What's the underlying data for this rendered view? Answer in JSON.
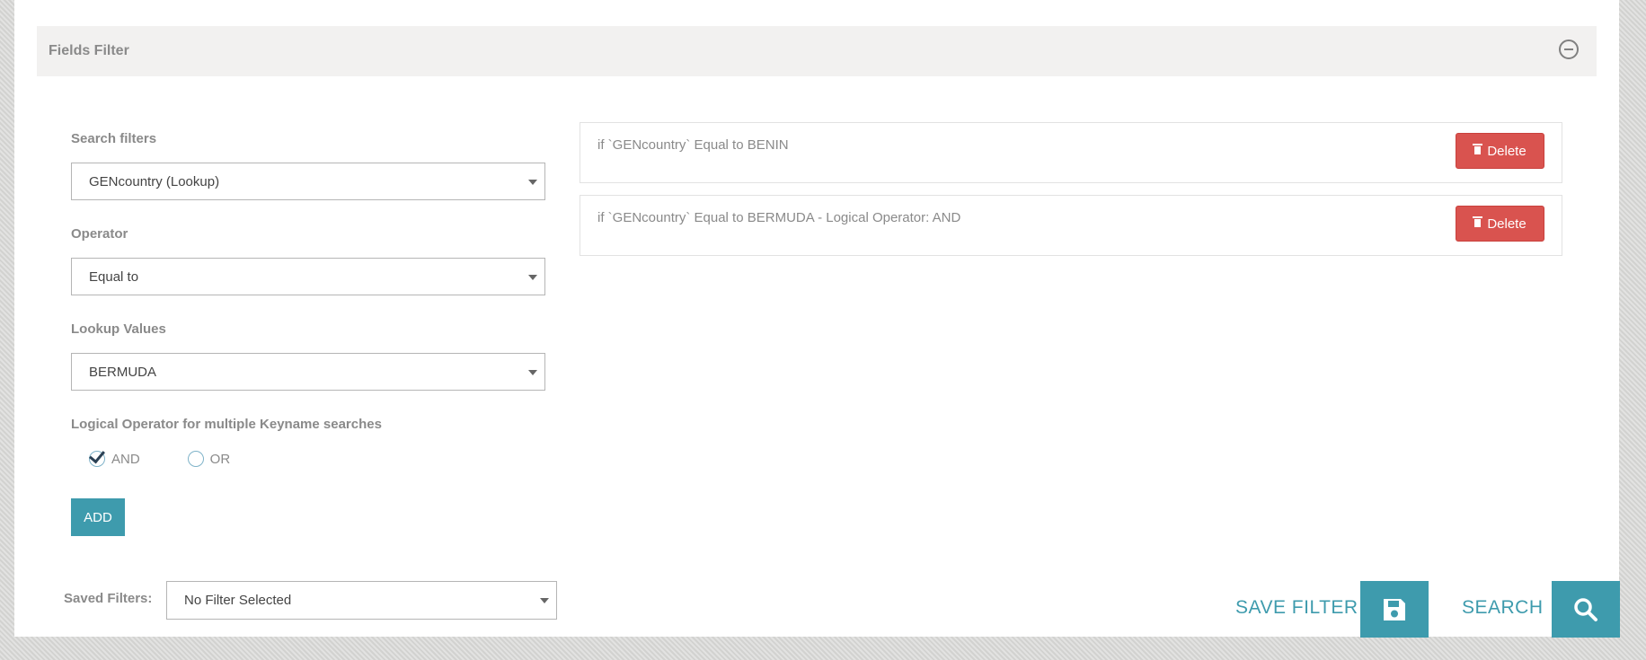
{
  "panel": {
    "title": "Fields Filter"
  },
  "form": {
    "search_filters_label": "Search filters",
    "search_filters_value": "GENcountry (Lookup)",
    "operator_label": "Operator",
    "operator_value": "Equal to",
    "lookup_label": "Lookup Values",
    "lookup_value": "BERMUDA",
    "logical_label": "Logical Operator for multiple Keyname searches",
    "logical_options": [
      {
        "label": "AND",
        "checked": true
      },
      {
        "label": "OR",
        "checked": false
      }
    ],
    "add_label": "ADD"
  },
  "filters": [
    {
      "text": "if `GENcountry` Equal to BENIN",
      "delete_label": "Delete"
    },
    {
      "text": "if `GENcountry` Equal to BERMUDA - Logical Operator: AND",
      "delete_label": "Delete"
    }
  ],
  "footer": {
    "saved_filters_label": "Saved Filters:",
    "saved_filters_value": "No Filter Selected",
    "save_filter_label": "SAVE FILTER",
    "search_label": "SEARCH",
    "save_icon": "floppy-disk-icon",
    "search_icon": "magnifier-icon"
  },
  "colors": {
    "accent": "#3e9bad",
    "danger": "#d9534f",
    "header_bg": "#f2f1f0",
    "label_text": "#8a8a8a"
  }
}
